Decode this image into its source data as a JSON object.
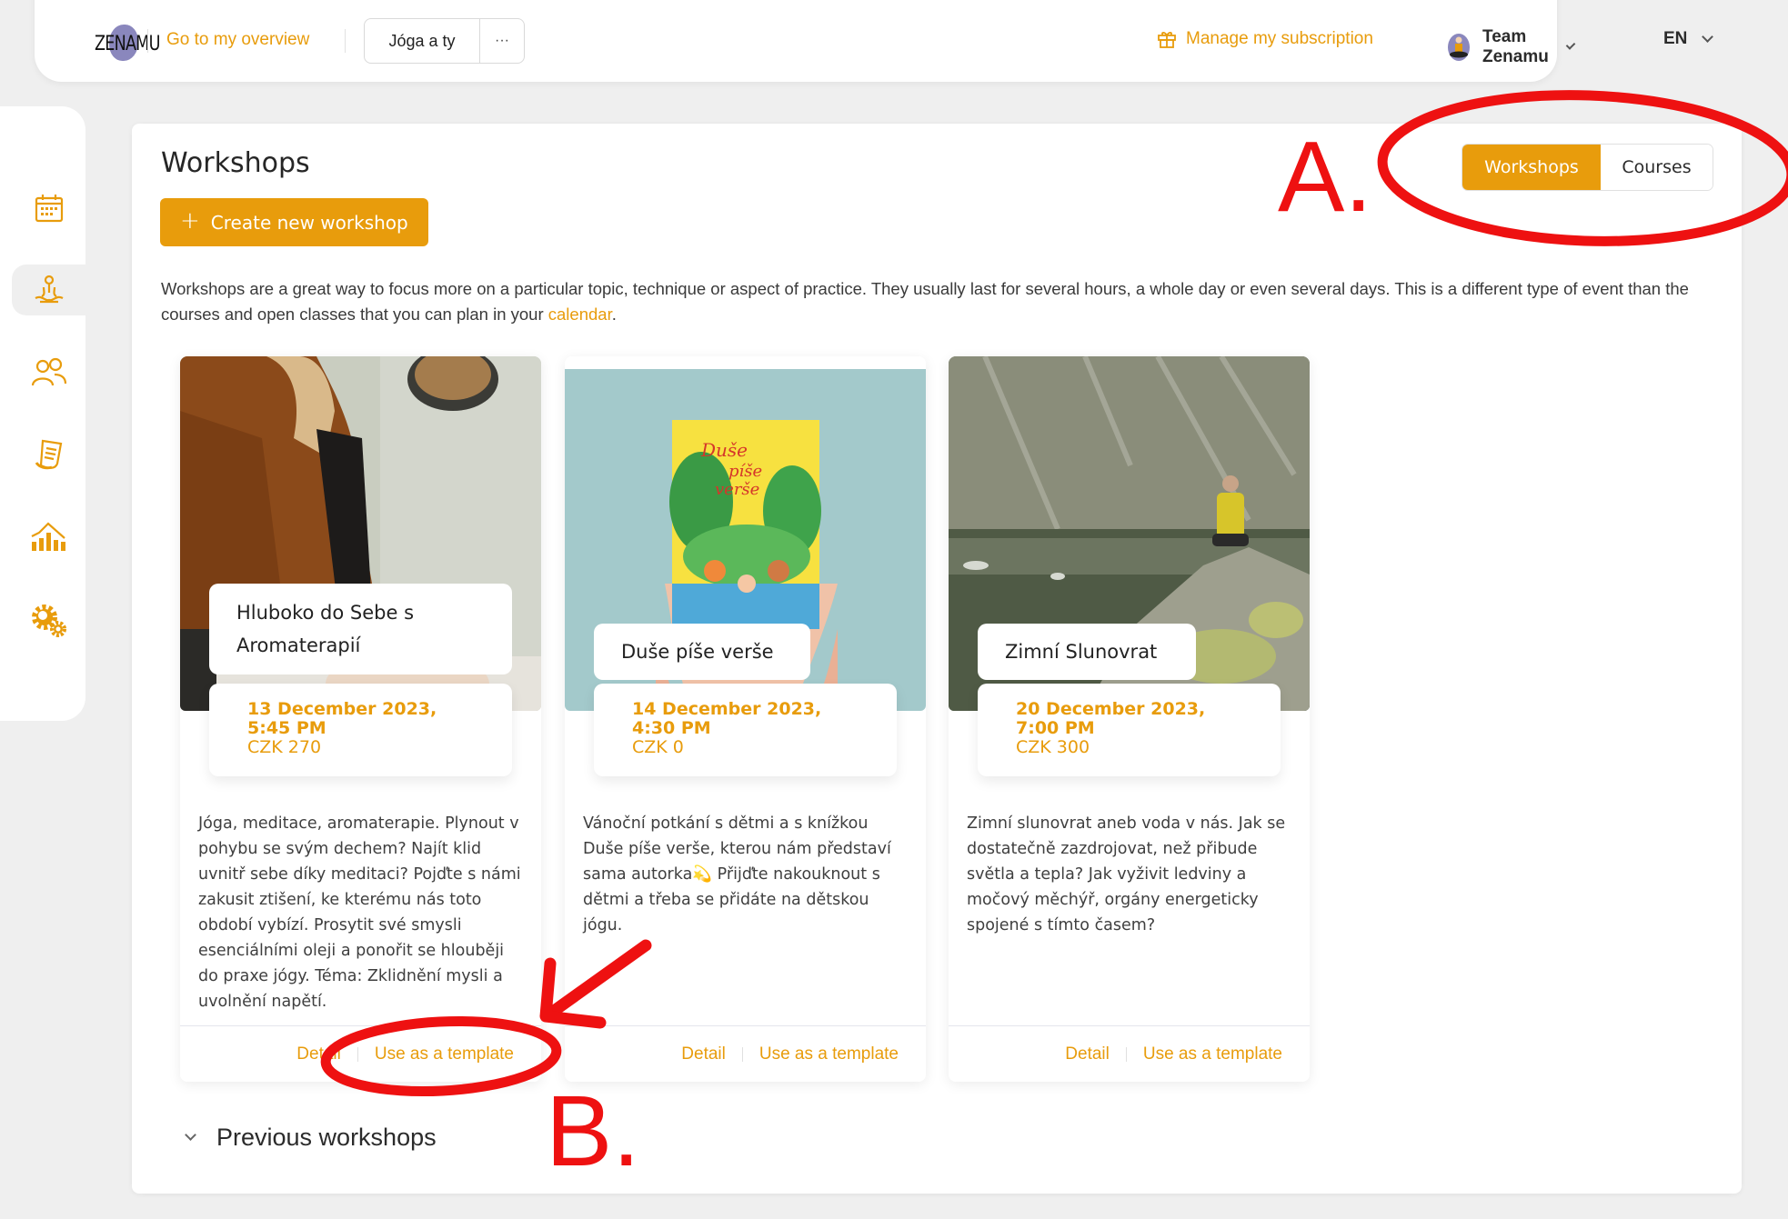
{
  "header": {
    "logo_text": "ZENAMU",
    "overview_link": "Go to my overview",
    "studio_name": "Jóga a ty",
    "more_label": "···",
    "subscription_link": "Manage my subscription",
    "account_name": "Team Zenamu",
    "language": "EN"
  },
  "sidebar": {
    "items": [
      {
        "name": "calendar",
        "active": false
      },
      {
        "name": "workshops",
        "active": true
      },
      {
        "name": "clients",
        "active": false
      },
      {
        "name": "invoices",
        "active": false
      },
      {
        "name": "statistics",
        "active": false
      },
      {
        "name": "settings",
        "active": false
      }
    ]
  },
  "main": {
    "title": "Workshops",
    "create_button": "Create new workshop",
    "toggle": {
      "workshops": "Workshops",
      "courses": "Courses",
      "selected": "Workshops"
    },
    "intro_text": "Workshops are a great way to focus more on a particular topic, technique or aspect of practice. They usually last for several hours, a whole day or even several days. This is a different type of event than the courses and open classes that you can plan in your ",
    "intro_link": "calendar",
    "intro_end": ".",
    "cards": [
      {
        "title": "Hluboko do Sebe s Aromaterapií",
        "date": "13 December 2023,",
        "time": "5:45 PM",
        "price": "CZK 270",
        "description": "Jóga, meditace, aromaterapie. Plynout v pohybu se svým dechem? Najít klid uvnitř sebe díky meditaci? Pojďte s námi zakusit ztišení, ke kterému nás toto období vybízí. Prosytit své smysli esenciálními oleji a ponořit se hlouběji do praxe jógy. Téma: Zklidnění mysli a uvolnění napětí.",
        "detail_link": "Detail",
        "template_link": "Use as a template"
      },
      {
        "title": "Duše píše verše",
        "date": "14 December 2023,",
        "time": "4:30 PM",
        "price": "CZK 0",
        "description": "Vánoční potkání s dětmi a s knížkou Duše píše verše, kterou nám představí sama autorka💫 Přijďte nakouknout s dětmi a třeba se přidáte na dětskou jógu.",
        "detail_link": "Detail",
        "template_link": "Use as a template"
      },
      {
        "title": "Zimní Slunovrat",
        "date": "20 December 2023,",
        "time": "7:00 PM",
        "price": "CZK 300",
        "description": "Zimní slunovrat aneb voda v nás. Jak se dostatečně zazdrojovat, než přibude světla a tepla? Jak vyživit ledviny a močový měchýř, orgány energeticky spojené s tímto časem?",
        "detail_link": "Detail",
        "template_link": "Use as a template"
      }
    ],
    "previous_section": "Previous workshops"
  },
  "annotations": {
    "a": "A.",
    "b": "B."
  },
  "colors": {
    "accent": "#e89c0c",
    "annotation": "#ee1111",
    "background": "#efefef"
  }
}
